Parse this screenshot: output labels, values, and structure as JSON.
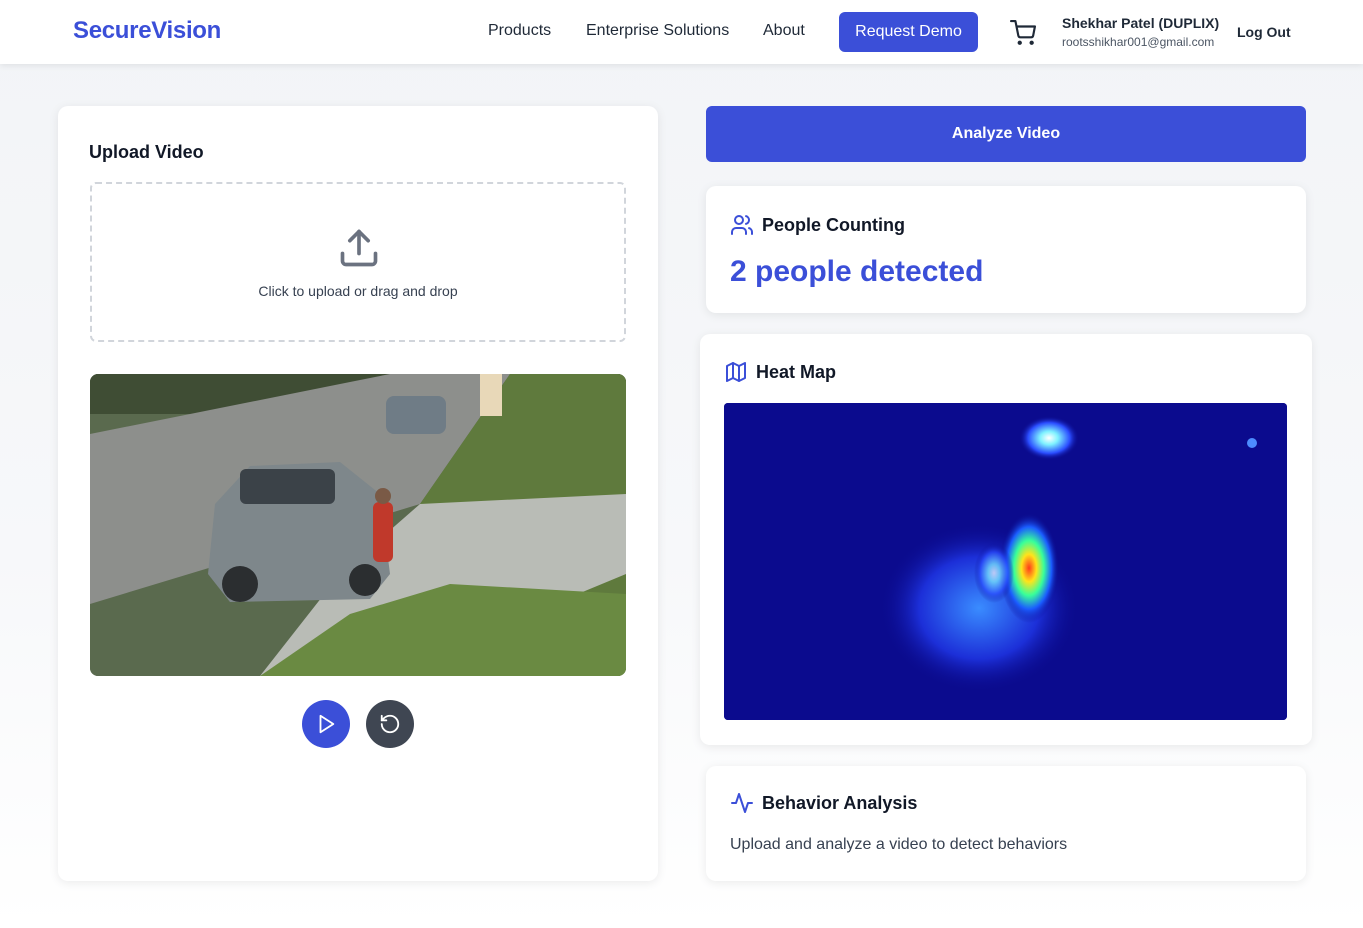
{
  "header": {
    "logo": "SecureVision",
    "nav": [
      "Products",
      "Enterprise Solutions",
      "About"
    ],
    "demo_button": "Request Demo",
    "user_name": "Shekhar Patel (DUPLIX)",
    "user_email": "rootsshikhar001@gmail.com",
    "logout": "Log Out"
  },
  "upload": {
    "title": "Upload Video",
    "dropzone_text": "Click to upload or drag and drop"
  },
  "analyze_button": "Analyze Video",
  "people_counting": {
    "title": "People Counting",
    "value": "2 people detected"
  },
  "heat_map": {
    "title": "Heat Map"
  },
  "behavior": {
    "title": "Behavior Analysis",
    "text": "Upload and analyze a video to detect behaviors"
  },
  "colors": {
    "accent": "#3b4fd8",
    "dark_button": "#3f4652"
  },
  "icons": [
    "shopping-cart-icon",
    "upload-icon",
    "play-icon",
    "rotate-ccw-icon",
    "users-icon",
    "map-icon",
    "activity-icon"
  ]
}
